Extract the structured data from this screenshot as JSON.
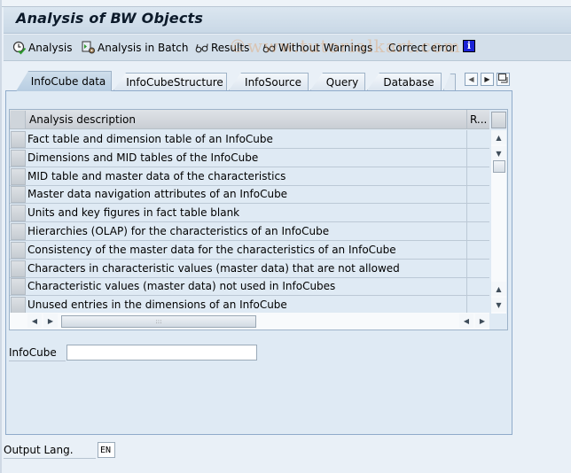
{
  "window": {
    "title": "Analysis of BW Objects"
  },
  "watermark": "©www.tutorialkart.com",
  "toolbar": {
    "buttons": [
      {
        "label": "Analysis",
        "icon": "clock-check-icon"
      },
      {
        "label": "Analysis in Batch",
        "icon": "batch-job-icon"
      },
      {
        "label": "Results",
        "icon": "glasses-icon"
      },
      {
        "label": "Without Warnings",
        "icon": "glasses-icon"
      },
      {
        "label": "Correct error",
        "icon": ""
      }
    ],
    "info_label": "i"
  },
  "tabs": {
    "items": [
      {
        "label": "InfoCube data",
        "active": true
      },
      {
        "label": "InfoCubeStructure",
        "active": false
      },
      {
        "label": "InfoSource",
        "active": false
      },
      {
        "label": "Query",
        "active": false
      },
      {
        "label": "Database",
        "active": false
      }
    ]
  },
  "table": {
    "columns": [
      "Analysis description",
      "R..."
    ],
    "rows": [
      "Fact table and dimension table of an InfoCube",
      "Dimensions and MID tables of the InfoCube",
      "MID table and master data of the characteristics",
      "Master data navigation attributes of an InfoCube",
      "Units and key figures in fact table blank",
      "Hierarchies (OLAP) for the characteristics of an InfoCube",
      "Consistency of the master data for the characteristics of an InfoCube",
      "Characters in characteristic values (master data) that are not allowed",
      "Characteristic values (master data) not used in InfoCubes",
      "Unused entries in the dimensions of an InfoCube"
    ]
  },
  "form": {
    "infocube_label": "InfoCube",
    "infocube_value": "",
    "output_lang_label": "Output Lang.",
    "output_lang_value": "EN"
  },
  "colors": {
    "info_icon_bg": "#1a23d6",
    "panel_bg": "#dfeaf4",
    "title_bar_bg": "#c9d8e6"
  }
}
